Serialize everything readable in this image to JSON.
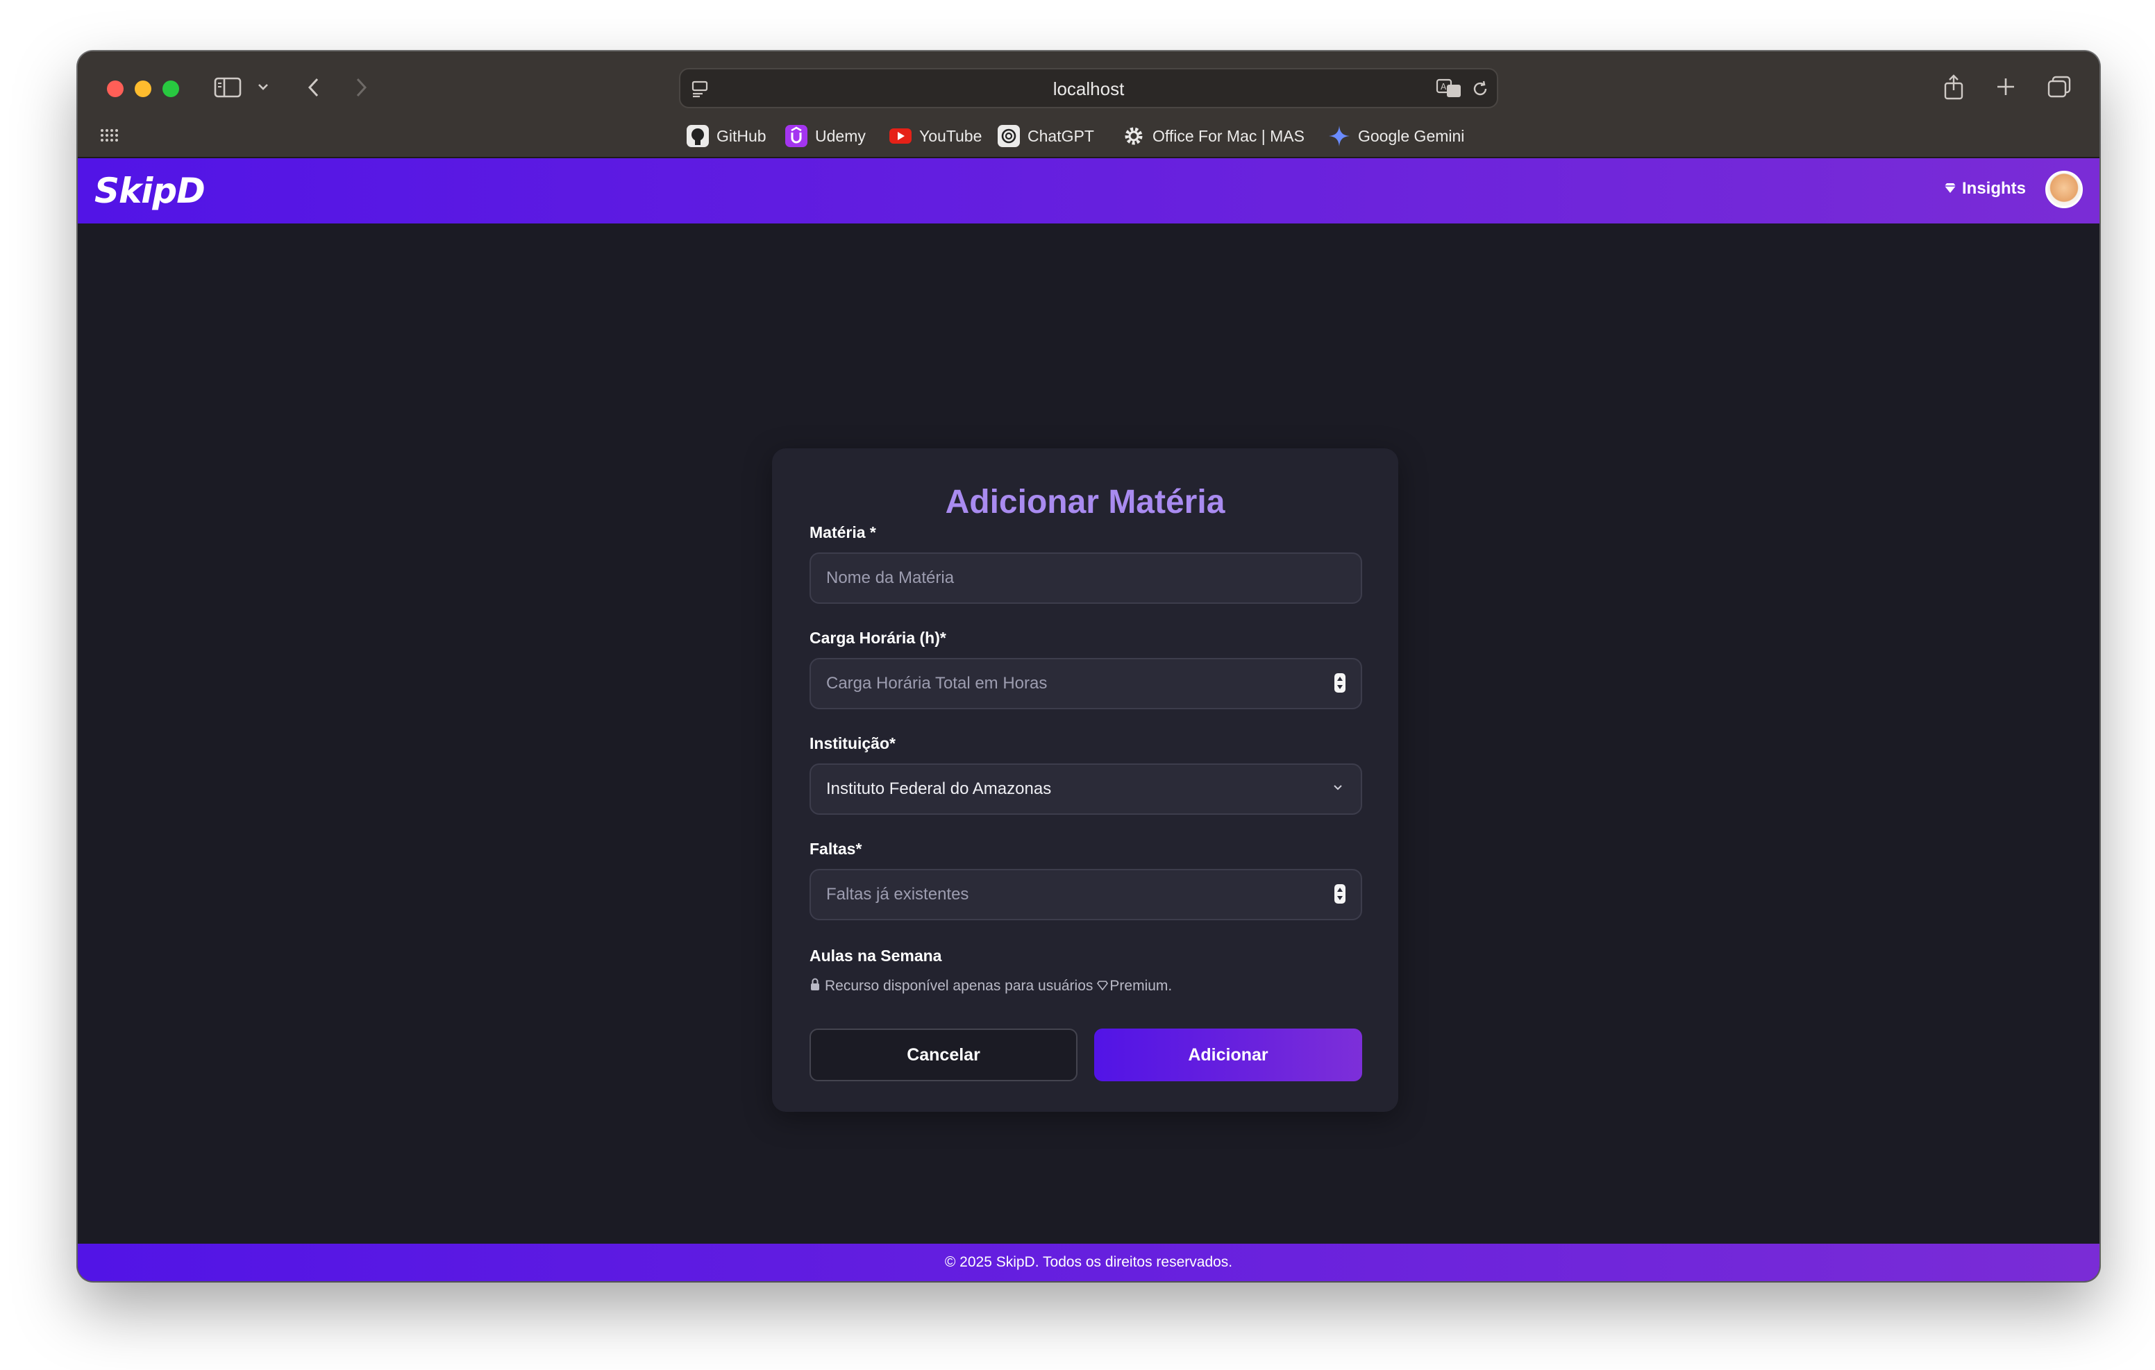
{
  "browser": {
    "url": "localhost",
    "bookmarks": [
      {
        "label": "GitHub",
        "icon": "github-icon"
      },
      {
        "label": "Udemy",
        "icon": "udemy-icon"
      },
      {
        "label": "YouTube",
        "icon": "youtube-icon"
      },
      {
        "label": "ChatGPT",
        "icon": "chatgpt-icon"
      },
      {
        "label": "Office For Mac | MAS",
        "icon": "gear-icon"
      },
      {
        "label": "Google Gemini",
        "icon": "gemini-icon"
      }
    ]
  },
  "app": {
    "logo": "SkipD",
    "insights_label": "Insights",
    "accent": "#5214e6",
    "accent_end": "#7a2cd6"
  },
  "form": {
    "title": "Adicionar Matéria",
    "materia": {
      "label": "Matéria *",
      "placeholder": "Nome da Matéria"
    },
    "carga": {
      "label": "Carga Horária (h)*",
      "placeholder": "Carga Horária Total em Horas"
    },
    "instituicao": {
      "label": "Instituição*",
      "value": "Instituto Federal do Amazonas"
    },
    "faltas": {
      "label": "Faltas*",
      "placeholder": "Faltas já existentes"
    },
    "aulas": {
      "label": "Aulas na Semana",
      "note_prefix": "Recurso disponível apenas para usuários",
      "note_premium": "Premium."
    },
    "cancel_label": "Cancelar",
    "submit_label": "Adicionar"
  },
  "footer": {
    "text": "© 2025 SkipD. Todos os direitos reservados."
  }
}
